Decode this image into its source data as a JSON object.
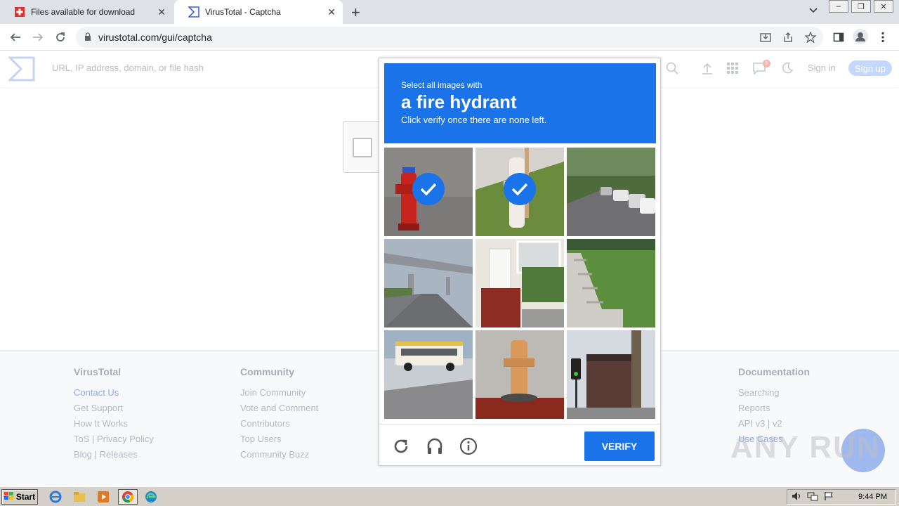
{
  "browser": {
    "tabs": [
      {
        "title": "Files available for download",
        "icon": "swiss-flag-icon",
        "active": false
      },
      {
        "title": "VirusTotal - Captcha",
        "icon": "virustotal-icon",
        "active": true
      }
    ],
    "url": "virustotal.com/gui/captcha",
    "new_tab_symbol": "+",
    "close_symbol": "✕"
  },
  "header": {
    "search_placeholder": "URL, IP address, domain, or file hash",
    "notification_count": "5",
    "sign_in": "Sign in",
    "sign_up": "Sign up"
  },
  "captcha": {
    "instruction_prefix": "Select all images with",
    "target": "a fire hydrant",
    "hint": "Click verify once there are none left.",
    "verify_label": "VERIFY",
    "tiles": [
      {
        "subject": "red fire hydrant",
        "selected": true
      },
      {
        "subject": "white fire hydrant on grass",
        "selected": true
      },
      {
        "subject": "parked cars on street",
        "selected": false
      },
      {
        "subject": "highway overpass",
        "selected": false
      },
      {
        "subject": "house porch with stairs",
        "selected": false
      },
      {
        "subject": "lawn with concrete steps",
        "selected": false
      },
      {
        "subject": "school bus",
        "selected": false
      },
      {
        "subject": "orange fire hydrant",
        "selected": false
      },
      {
        "subject": "traffic light and building",
        "selected": false
      }
    ]
  },
  "footer": {
    "columns": [
      {
        "heading": "VirusTotal",
        "links": [
          "Contact Us",
          "Get Support",
          "How It Works",
          "ToS | Privacy Policy",
          "Blog | Releases"
        ]
      },
      {
        "heading": "Community",
        "links": [
          "Join Community",
          "Vote and Comment",
          "Contributors",
          "Top Users",
          "Community Buzz"
        ]
      },
      {
        "heading": "Documentation",
        "links": [
          "Searching",
          "Reports",
          "API v3 | v2",
          "Use Cases"
        ]
      }
    ]
  },
  "watermark": "ANY RUN",
  "taskbar": {
    "start_label": "Start",
    "clock": "9:44 PM"
  },
  "colors": {
    "captcha_blue": "#1a73e8",
    "vt_blue": "#3b61d6"
  }
}
